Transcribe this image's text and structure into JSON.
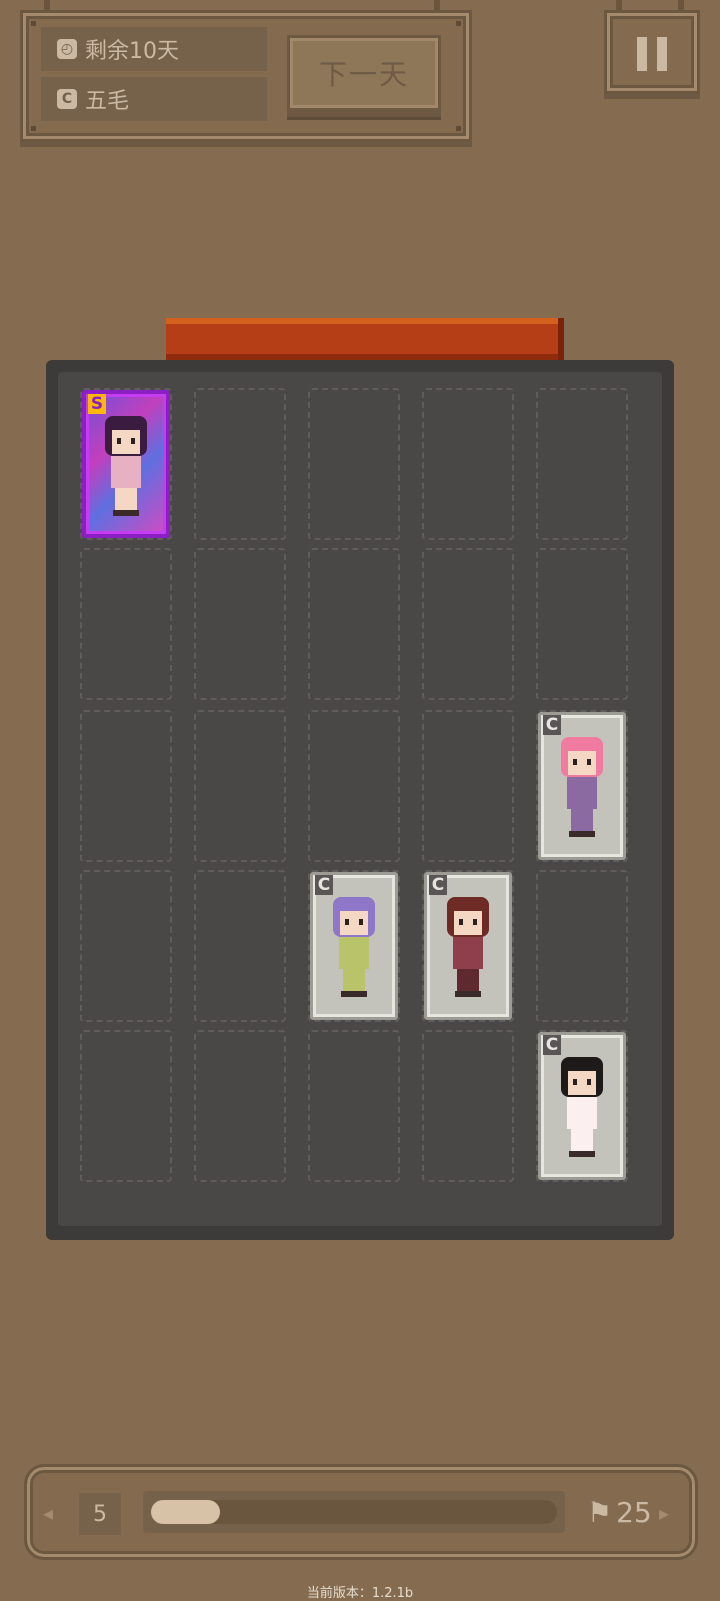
{
  "top_panel": {
    "days_remaining": "剩余10天",
    "money": "五毛",
    "next_day_button": "下一天"
  },
  "board": {
    "columns": 5,
    "rows": 5,
    "cards": [
      {
        "rank": "S",
        "row": 0,
        "col": 0,
        "style": "rare",
        "character": "girl-glasses"
      },
      {
        "rank": "C",
        "row": 2,
        "col": 4,
        "style": "common",
        "character": "pink-hair-girl"
      },
      {
        "rank": "C",
        "row": 3,
        "col": 2,
        "style": "common",
        "character": "purple-hair-girl"
      },
      {
        "rank": "C",
        "row": 3,
        "col": 3,
        "style": "common",
        "character": "brown-hair-boy"
      },
      {
        "rank": "C",
        "row": 4,
        "col": 4,
        "style": "common",
        "character": "black-hair-girl-white-dress"
      }
    ]
  },
  "bottom_bar": {
    "current_level": "5",
    "goal_level": "25",
    "progress_fraction": 0.17
  },
  "footer": {
    "version": "当前版本：1.2.1b"
  },
  "colors": {
    "background": "#856c51",
    "board": "#3d3a3a",
    "board_tab": "#b63e16",
    "rare_border": "#8b1fc4",
    "rank_S": "#ffb800"
  }
}
